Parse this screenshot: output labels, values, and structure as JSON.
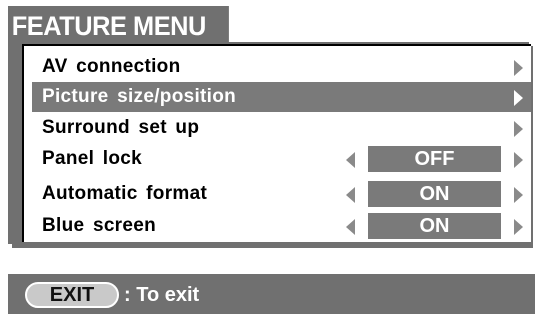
{
  "menu": {
    "title": "FEATURE MENU",
    "items": [
      {
        "label": "AV connection",
        "value": "",
        "selected": false
      },
      {
        "label": "Picture size/position",
        "value": "",
        "selected": true
      },
      {
        "label": "Surround set up",
        "value": "",
        "selected": false
      },
      {
        "label": "Panel lock",
        "value": "OFF",
        "selected": false
      },
      {
        "label": "Automatic format",
        "value": "ON",
        "selected": false
      },
      {
        "label": "Blue screen",
        "value": "ON",
        "selected": false
      }
    ]
  },
  "footer": {
    "exit_button": "EXIT",
    "exit_hint": ": To exit"
  },
  "icons": {
    "left": "triangle-left-icon",
    "right": "triangle-right-icon"
  },
  "colors": {
    "panel": "#707070",
    "highlight": "#7a7a7a",
    "arrow": "#8a8a8a"
  }
}
